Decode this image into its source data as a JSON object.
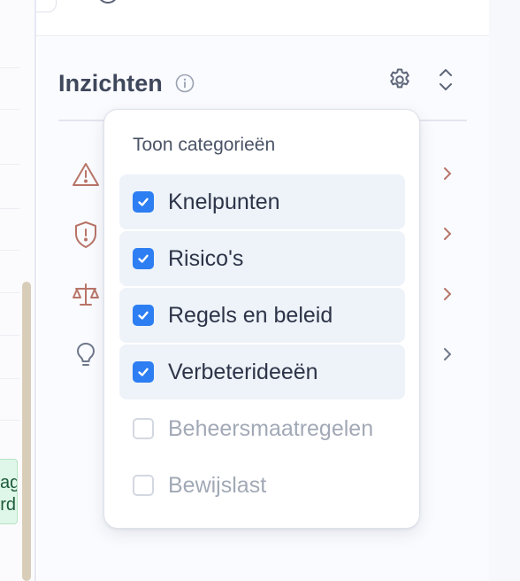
{
  "panel": {
    "title": "Inzichten",
    "icons": {
      "info": "info-icon",
      "settings": "gear-icon",
      "sort": "chevron-up-down-icon"
    },
    "rows": [
      {
        "icon": "warning-triangle-icon",
        "color": "#b87468"
      },
      {
        "icon": "shield-alert-icon",
        "color": "#b87468"
      },
      {
        "icon": "scales-icon",
        "color": "#b87468"
      },
      {
        "icon": "lightbulb-icon",
        "color": "#6f788b"
      }
    ]
  },
  "popover": {
    "title": "Toon categorieën",
    "options": [
      {
        "label": "Knelpunten",
        "checked": true
      },
      {
        "label": "Risico's",
        "checked": true
      },
      {
        "label": "Regels en beleid",
        "checked": true
      },
      {
        "label": "Verbeterideeën",
        "checked": true
      },
      {
        "label": "Beheersmaatregelen",
        "checked": false
      },
      {
        "label": "Bewijslast",
        "checked": false
      }
    ]
  },
  "left": {
    "tag_lines": [
      "ag",
      "rd"
    ]
  },
  "colors": {
    "accent": "#2c7ef2",
    "risk_icon": "#b87468",
    "title": "#3e475b",
    "muted_label": "#a2a9b6"
  }
}
